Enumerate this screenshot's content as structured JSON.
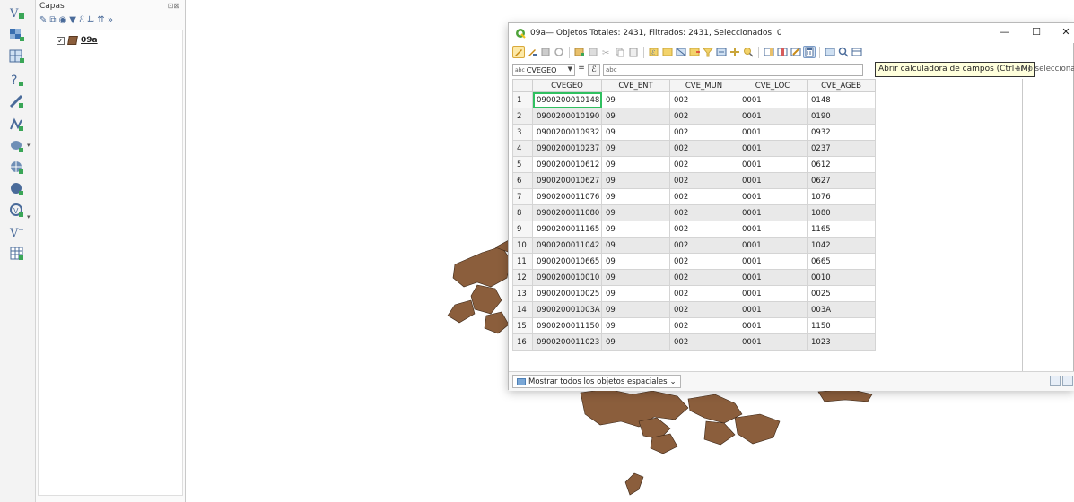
{
  "layers_panel": {
    "title": "Capas",
    "panel_controls": "⊡⊠",
    "toolbar_icons": [
      "paint-brush-icon",
      "layers-icon",
      "eye-icon",
      "filter-icon",
      "expression-filter-icon",
      "expand-all-icon",
      "collapse-all-icon",
      "more-icon"
    ],
    "layers": [
      {
        "name": "09a",
        "checked": true,
        "color": "#8b5e3c"
      }
    ]
  },
  "left_toolbar": {
    "icons": [
      "new-vector-layer-icon",
      "add-raster-icon",
      "add-mesh-icon",
      "add-delimited-text-icon",
      "add-spatialite-icon",
      "add-wms-icon",
      "add-postgis-icon",
      "add-wfs-icon",
      "add-wcs-icon",
      "add-virtual-layer-icon",
      "add-table-icon"
    ]
  },
  "attribute_table": {
    "window_title": "09a— Objetos Totales: 2431, Filtrados: 2431, Seleccionados: 0",
    "window_controls": {
      "minimize": "—",
      "maximize": "☐",
      "close": "✕"
    },
    "tooltip": "Abrir calculadora de campos (Ctrl+M)",
    "tooltip_tail": "ar lo seleccionado",
    "field_select": {
      "prefix": "abc",
      "value": "CVEGEO"
    },
    "eq_sign": "=",
    "expr_button": "ℰ",
    "expr_placeholder": "abc",
    "columns": [
      "CVEGEO",
      "CVE_ENT",
      "CVE_MUN",
      "CVE_LOC",
      "CVE_AGEB"
    ],
    "rows": [
      [
        "1",
        "0900200010148",
        "09",
        "002",
        "0001",
        "0148"
      ],
      [
        "2",
        "0900200010190",
        "09",
        "002",
        "0001",
        "0190"
      ],
      [
        "3",
        "0900200010932",
        "09",
        "002",
        "0001",
        "0932"
      ],
      [
        "4",
        "0900200010237",
        "09",
        "002",
        "0001",
        "0237"
      ],
      [
        "5",
        "0900200010612",
        "09",
        "002",
        "0001",
        "0612"
      ],
      [
        "6",
        "0900200010627",
        "09",
        "002",
        "0001",
        "0627"
      ],
      [
        "7",
        "0900200011076",
        "09",
        "002",
        "0001",
        "1076"
      ],
      [
        "8",
        "0900200011080",
        "09",
        "002",
        "0001",
        "1080"
      ],
      [
        "9",
        "0900200011165",
        "09",
        "002",
        "0001",
        "1165"
      ],
      [
        "10",
        "0900200011042",
        "09",
        "002",
        "0001",
        "1042"
      ],
      [
        "11",
        "0900200010665",
        "09",
        "002",
        "0001",
        "0665"
      ],
      [
        "12",
        "0900200010010",
        "09",
        "002",
        "0001",
        "0010"
      ],
      [
        "13",
        "0900200010025",
        "09",
        "002",
        "0001",
        "0025"
      ],
      [
        "14",
        "090020001003A",
        "09",
        "002",
        "0001",
        "003A"
      ],
      [
        "15",
        "0900200011150",
        "09",
        "002",
        "0001",
        "1150"
      ],
      [
        "16",
        "0900200011023",
        "09",
        "002",
        "0001",
        "1023"
      ]
    ],
    "show_button": "Mostrar todos los objetos espaciales"
  },
  "colors": {
    "polygon_fill": "#8b5e3c",
    "polygon_stroke": "#3b2616",
    "selected_cell_outline": "#30c060",
    "tooltip_bg": "#ffffdc"
  }
}
